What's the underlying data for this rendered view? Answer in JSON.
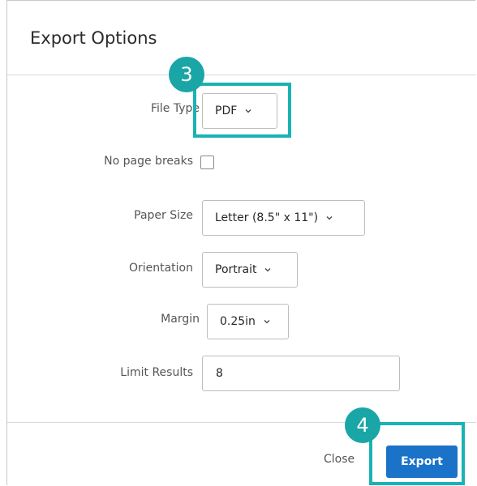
{
  "dialog": {
    "title": "Export Options"
  },
  "form": {
    "file_type": {
      "label": "File Type",
      "value": "PDF"
    },
    "no_page_breaks": {
      "label": "No page breaks",
      "checked": false
    },
    "paper_size": {
      "label": "Paper Size",
      "value": "Letter (8.5\" x 11\")"
    },
    "orientation": {
      "label": "Orientation",
      "value": "Portrait"
    },
    "margin": {
      "label": "Margin",
      "value": "0.25in"
    },
    "limit_results": {
      "label": "Limit Results",
      "value": "8"
    }
  },
  "footer": {
    "close_label": "Close",
    "export_label": "Export"
  },
  "annotations": {
    "step_3": "3",
    "step_4": "4"
  },
  "colors": {
    "highlight": "#1ab3b3",
    "badge": "#1aa6a6",
    "primary_button": "#1a73c9"
  },
  "icons": {
    "dropdown": "chevron-down-icon"
  }
}
